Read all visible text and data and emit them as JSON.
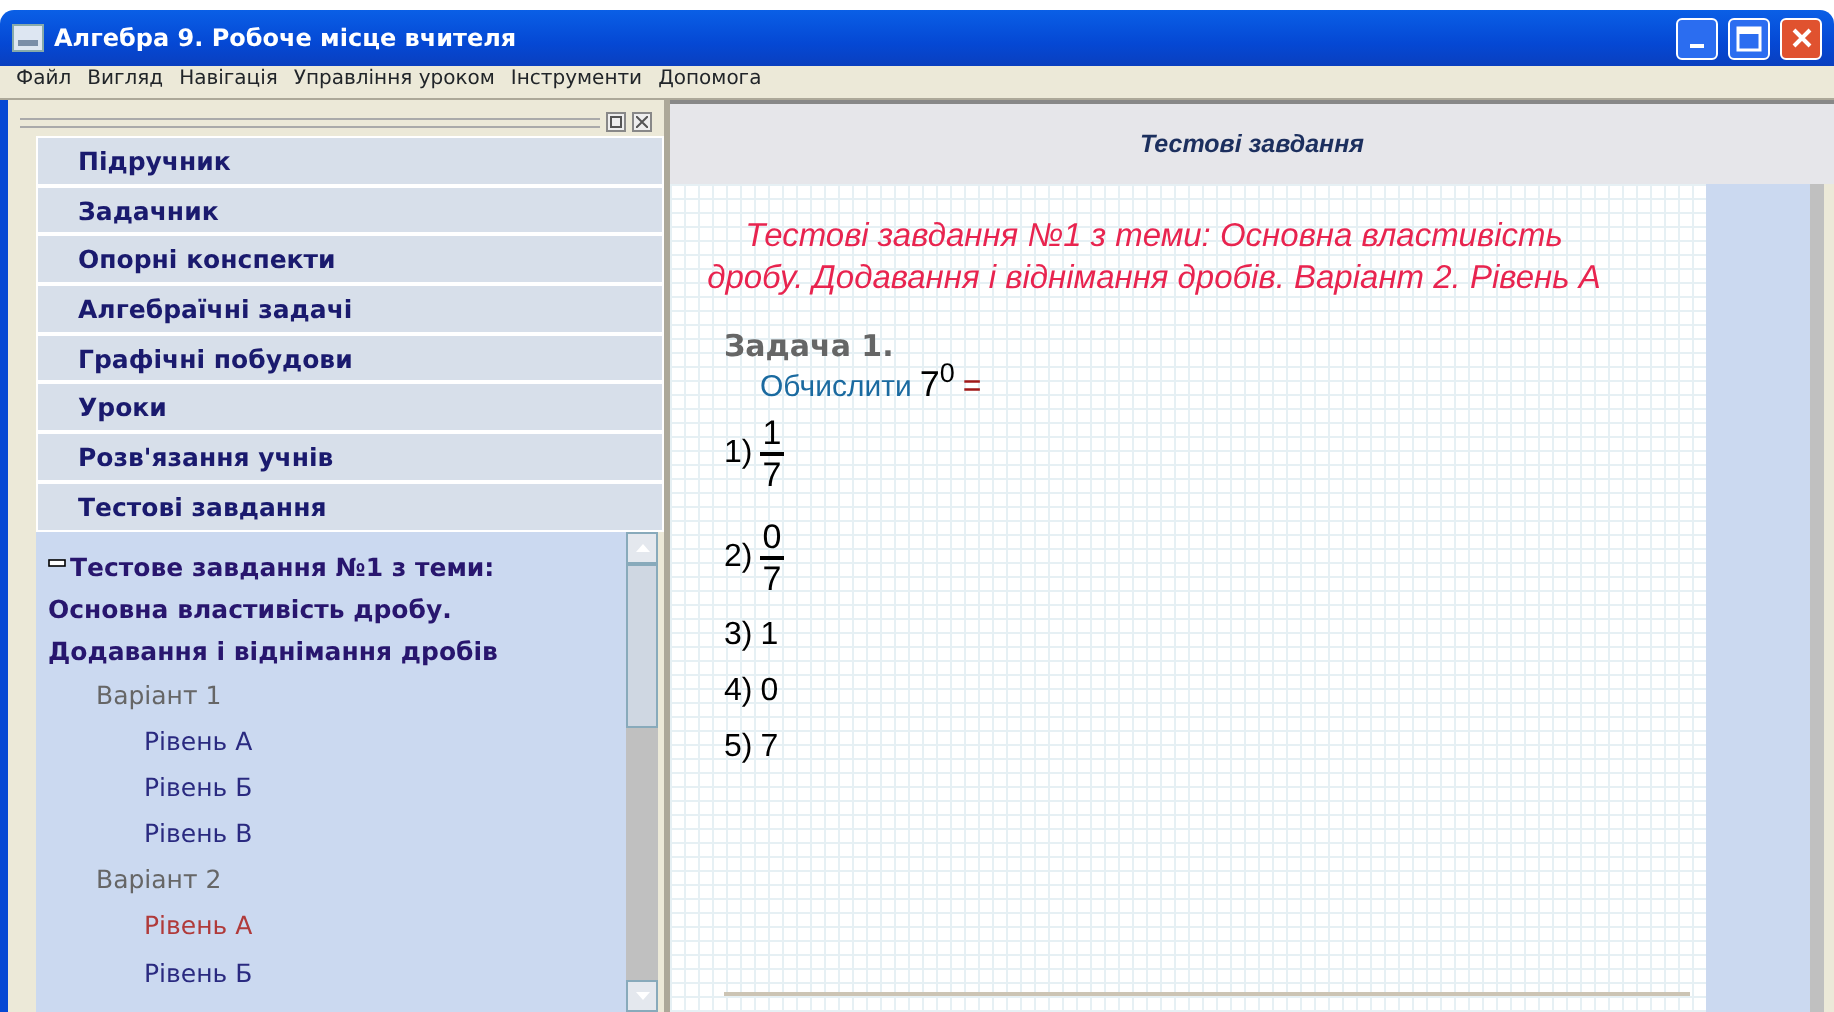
{
  "window": {
    "title": "Алгебра 9. Робоче місце вчителя"
  },
  "menu": [
    "Файл",
    "Вигляд",
    "Навігація",
    "Управління уроком",
    "Інструменти",
    "Допомога"
  ],
  "sidebar": {
    "sections": [
      {
        "label": "Підручник"
      },
      {
        "label": "Задачник"
      },
      {
        "label": "Опорні конспекти"
      },
      {
        "label": "Алгебраїчні задачі"
      },
      {
        "label": "Графічні побудови"
      },
      {
        "label": "Уроки"
      },
      {
        "label": "Розв'язання учнів"
      },
      {
        "label": "Тестові завдання"
      }
    ],
    "tree": [
      {
        "label": "Тестове завдання №1 з теми: Основна властивість дробу. Додавання і віднімання дробів",
        "expanded": true,
        "children": [
          {
            "label": "Варіант 1",
            "children": [
              {
                "label": "Рівень А",
                "selected": false
              },
              {
                "label": "Рівень Б",
                "selected": false
              },
              {
                "label": "Рівень В",
                "selected": false
              }
            ]
          },
          {
            "label": "Варіант 2",
            "children": [
              {
                "label": "Рівень А",
                "selected": true
              },
              {
                "label": "Рівень Б",
                "selected": false
              }
            ]
          }
        ]
      }
    ]
  },
  "content": {
    "header": "Тестові завдання",
    "title": "Тестові завдання №1 з теми: Основна властивість дробу. Додавання і віднімання дробів. Варіант 2. Рівень А",
    "task": {
      "heading": "Задача 1.",
      "prompt": "Обчислити",
      "expression": "7$^{0}$",
      "equals": "=",
      "answers": [
        {
          "number": "1)",
          "kind": "fraction",
          "numerator": "1",
          "denominator": "7"
        },
        {
          "number": "2)",
          "kind": "fraction",
          "numerator": "0",
          "denominator": "7"
        },
        {
          "number": "3)",
          "kind": "number",
          "value": "1"
        },
        {
          "number": "4)",
          "kind": "number",
          "value": "0"
        },
        {
          "number": "5)",
          "kind": "number",
          "value": "7"
        }
      ]
    }
  }
}
